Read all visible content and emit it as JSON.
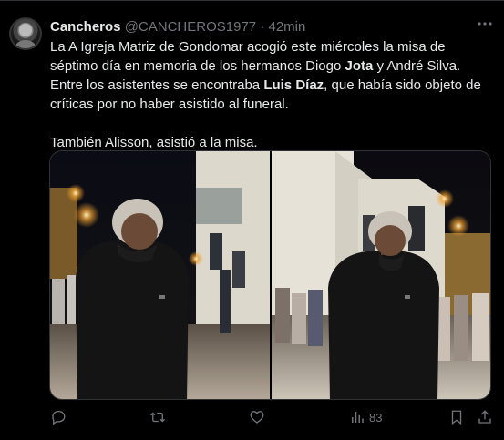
{
  "tweet": {
    "author_name": "Cancheros",
    "handle": "@CANCHEROS1977",
    "separator": "·",
    "time": "42min",
    "more_icon": "ellipsis-icon",
    "text_part1_a": "La A Igreja Matriz de Gondomar acogió este miércoles la misa de séptimo día en memoria de los hermanos Diogo ",
    "text_part1_bold1": "Jota",
    "text_part1_b": " y André Silva. Entre los asistentes se encontraba ",
    "text_part1_bold2": "Luis Díaz",
    "text_part1_c": ", que había sido objeto de críticas por no haber asistido al funeral.",
    "text_part2": "También Alisson, asistió a la misa.",
    "actions": {
      "reply_icon": "reply-icon",
      "retweet_icon": "retweet-icon",
      "like_icon": "heart-icon",
      "views_icon": "views-icon",
      "views_count": "83",
      "bookmark_icon": "bookmark-icon",
      "share_icon": "share-icon"
    }
  },
  "colors": {
    "background": "#000000",
    "text": "#e7e9ea",
    "muted": "#71767b",
    "border": "#2f3336"
  }
}
